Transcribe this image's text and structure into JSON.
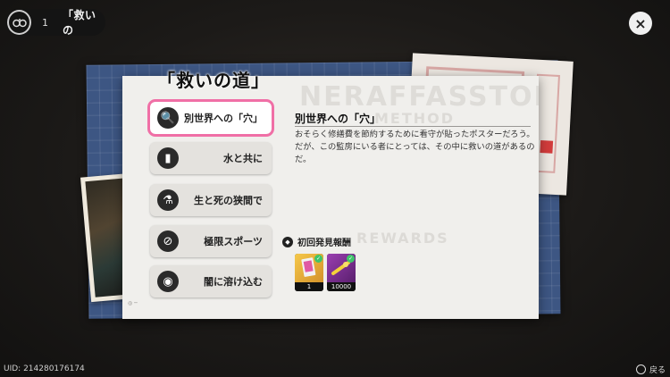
{
  "header": {
    "count": "1",
    "title": "「救いの",
    "close_label": "×"
  },
  "heading": "「救いの道」",
  "watermarks": {
    "top": "NERAFFASSTOE",
    "method": "METHOD",
    "rewards": "REWARDS"
  },
  "menu": [
    {
      "label": "別世界への「穴」",
      "icon": "magnifier-icon",
      "glyph": "🔍",
      "active": true
    },
    {
      "label": "水と共に",
      "icon": "bottle-icon",
      "glyph": "▮",
      "active": false
    },
    {
      "label": "生と死の狭間で",
      "icon": "flask-icon",
      "glyph": "⚗",
      "active": false
    },
    {
      "label": "極限スポーツ",
      "icon": "no-sign-icon",
      "glyph": "⊘",
      "active": false
    },
    {
      "label": "闇に溶け込む",
      "icon": "mask-icon",
      "glyph": "◉",
      "active": false
    }
  ],
  "detail": {
    "title": "別世界への「穴」",
    "body": "おそらく修繕費を節約するために看守が貼ったポスターだろう。だが、この監房にいる者にとっては、その中に救いの道があるのだ。"
  },
  "rewards": {
    "title": "初回発見報酬",
    "items": [
      {
        "qty": "1",
        "color": "#e8b93a",
        "icon": "card-pack-icon"
      },
      {
        "qty": "10000",
        "color": "#7a2f8c",
        "icon": "currency-icon"
      }
    ]
  },
  "footer": {
    "uid": "UID: 214280176174",
    "back_label": "戻る"
  }
}
